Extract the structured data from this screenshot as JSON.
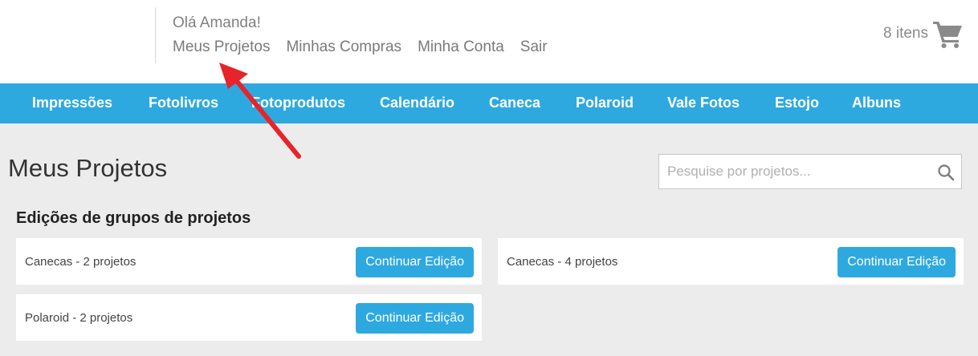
{
  "header": {
    "greeting": "Olá Amanda!",
    "links": [
      {
        "label": "Meus Projetos"
      },
      {
        "label": "Minhas Compras"
      },
      {
        "label": "Minha Conta"
      },
      {
        "label": "Sair"
      }
    ],
    "cart": {
      "count_label": "8 itens",
      "icon": "cart-icon"
    }
  },
  "nav": {
    "items": [
      {
        "label": "Impressões"
      },
      {
        "label": "Fotolivros"
      },
      {
        "label": "Fotoprodutos"
      },
      {
        "label": "Calendário"
      },
      {
        "label": "Caneca"
      },
      {
        "label": "Polaroid"
      },
      {
        "label": "Vale Fotos"
      },
      {
        "label": "Estojo"
      },
      {
        "label": "Albuns"
      }
    ]
  },
  "main": {
    "title": "Meus Projetos",
    "search": {
      "placeholder": "Pesquise por projetos...",
      "value": "",
      "icon": "search-icon"
    },
    "section_title": "Edições de grupos de projetos",
    "groups": [
      {
        "label": "Canecas - 2 projetos",
        "button": "Continuar Edição"
      },
      {
        "label": "Canecas - 4 projetos",
        "button": "Continuar Edição"
      },
      {
        "label": "Polaroid - 2 projetos",
        "button": "Continuar Edição"
      }
    ]
  },
  "colors": {
    "accent": "#2ea9e0",
    "annotation_arrow": "#e8232a",
    "background": "#ececec"
  }
}
